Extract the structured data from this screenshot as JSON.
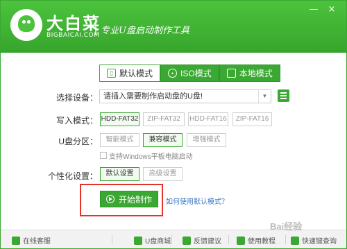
{
  "header": {
    "brand": "大白菜",
    "brand_sub": "BIGBAICAI.COM",
    "slogan": "专业U盘启动制作工具",
    "minimize": "—",
    "close": "×"
  },
  "tabs": [
    {
      "label": "默认模式",
      "active": true,
      "icon": "usb-icon"
    },
    {
      "label": "ISO模式",
      "active": false,
      "icon": "disc-icon"
    },
    {
      "label": "本地模式",
      "active": false,
      "icon": "monitor-icon"
    }
  ],
  "form": {
    "device_label": "选择设备：",
    "device_value": "请插入需要制作启动盘的U盘!",
    "write_mode_label": "写入模式：",
    "write_modes": [
      "HDD-FAT32",
      "ZIP-FAT32",
      "HDD-FAT16",
      "ZIP-FAT16"
    ],
    "partition_label": "U盘分区：",
    "partitions": [
      "智能模式",
      "兼容模式",
      "增强模式"
    ],
    "tablet_checkbox": "支持Windows平板电脑启动",
    "personalize_label": "个性化设置：",
    "personalize_opts": [
      "默认设置",
      "高级设置"
    ],
    "start_button": "开始制作",
    "help_link": "如何使用默认模式？"
  },
  "footer": {
    "items": [
      "在线客服",
      "U盘商城",
      "反馈建议",
      "使用教程",
      "快速键查询"
    ]
  },
  "watermark": "Bai经验",
  "colors": {
    "accent": "#3aa832",
    "highlight": "#e5322d",
    "link": "#3a78c2"
  }
}
